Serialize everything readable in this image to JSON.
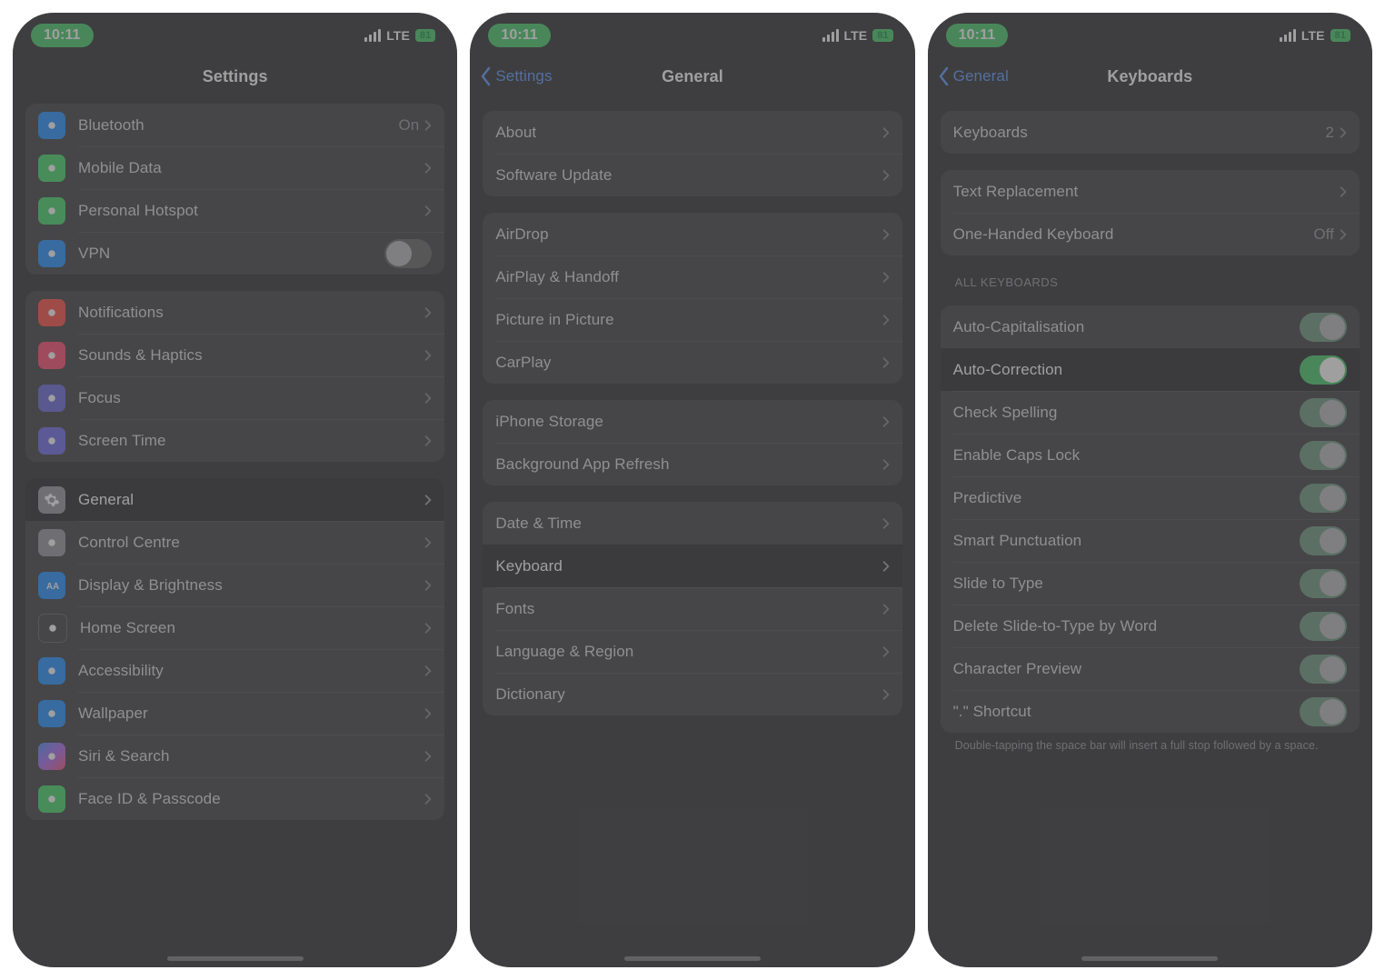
{
  "status": {
    "time": "10:11",
    "net": "LTE",
    "battery": "81"
  },
  "screen1": {
    "title": "Settings",
    "rows_top": [
      {
        "label": "Bluetooth",
        "value": "On",
        "icon": "bluetooth",
        "cls": "ic-blue"
      },
      {
        "label": "Mobile Data",
        "icon": "antenna",
        "cls": "ic-green"
      },
      {
        "label": "Personal Hotspot",
        "icon": "link",
        "cls": "ic-green2"
      },
      {
        "label": "VPN",
        "icon": "vpn",
        "cls": "ic-vpn",
        "vpn": true
      }
    ],
    "rows_mid": [
      {
        "label": "Notifications",
        "icon": "bell",
        "cls": "ic-red"
      },
      {
        "label": "Sounds & Haptics",
        "icon": "speaker",
        "cls": "ic-pink"
      },
      {
        "label": "Focus",
        "icon": "moon",
        "cls": "ic-purple"
      },
      {
        "label": "Screen Time",
        "icon": "hourglass",
        "cls": "ic-teal"
      }
    ],
    "rows_bot": [
      {
        "label": "General",
        "icon": "gear",
        "cls": "ic-grey",
        "hl": true
      },
      {
        "label": "Control Centre",
        "icon": "sliders",
        "cls": "ic-grey2"
      },
      {
        "label": "Display & Brightness",
        "icon": "aa",
        "cls": "ic-lblue"
      },
      {
        "label": "Home Screen",
        "icon": "grid",
        "cls": "ic-dot"
      },
      {
        "label": "Accessibility",
        "icon": "person",
        "cls": "ic-cyan"
      },
      {
        "label": "Wallpaper",
        "icon": "flower",
        "cls": "ic-atom"
      },
      {
        "label": "Siri & Search",
        "icon": "siri",
        "cls": "ic-siri"
      },
      {
        "label": "Face ID & Passcode",
        "icon": "face",
        "cls": "ic-face"
      }
    ]
  },
  "screen2": {
    "back": "Settings",
    "title": "General",
    "g1": [
      "About",
      "Software Update"
    ],
    "g2": [
      "AirDrop",
      "AirPlay & Handoff",
      "Picture in Picture",
      "CarPlay"
    ],
    "g3": [
      "iPhone Storage",
      "Background App Refresh"
    ],
    "g4": [
      {
        "label": "Date & Time"
      },
      {
        "label": "Keyboard",
        "hl": true
      },
      {
        "label": "Fonts"
      },
      {
        "label": "Language & Region"
      },
      {
        "label": "Dictionary"
      }
    ]
  },
  "screen3": {
    "back": "General",
    "title": "Keyboards",
    "g1": [
      {
        "label": "Keyboards",
        "value": "2"
      }
    ],
    "g2": [
      {
        "label": "Text Replacement"
      },
      {
        "label": "One-Handed Keyboard",
        "value": "Off"
      }
    ],
    "section": "ALL KEYBOARDS",
    "toggles": [
      {
        "label": "Auto-Capitalisation",
        "on": true
      },
      {
        "label": "Auto-Correction",
        "on": true,
        "hl": true
      },
      {
        "label": "Check Spelling",
        "on": true
      },
      {
        "label": "Enable Caps Lock",
        "on": true
      },
      {
        "label": "Predictive",
        "on": true
      },
      {
        "label": "Smart Punctuation",
        "on": true
      },
      {
        "label": "Slide to Type",
        "on": true
      },
      {
        "label": "Delete Slide-to-Type by Word",
        "on": true
      },
      {
        "label": "Character Preview",
        "on": true
      },
      {
        "label": "\".\" Shortcut",
        "on": true
      }
    ],
    "footer": "Double-tapping the space bar will insert a full stop followed by a space."
  }
}
